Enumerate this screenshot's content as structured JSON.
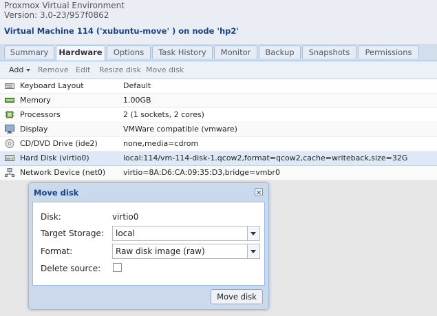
{
  "app": {
    "line1": "Proxmox Virtual Environment",
    "line2": "Version: 3.0-23/957f0862"
  },
  "vm_title": "Virtual Machine 114 ('xubuntu-move' ) on node 'hp2'",
  "tabs": [
    "Summary",
    "Hardware",
    "Options",
    "Task History",
    "Monitor",
    "Backup",
    "Snapshots",
    "Permissions"
  ],
  "active_tab": "Hardware",
  "toolbar": {
    "add": "Add",
    "remove": "Remove",
    "edit": "Edit",
    "resize": "Resize disk",
    "move": "Move disk"
  },
  "hardware": [
    {
      "label": "Keyboard Layout",
      "value": "Default",
      "icon": "keyboard-icon"
    },
    {
      "label": "Memory",
      "value": "1.00GB",
      "icon": "memory-icon"
    },
    {
      "label": "Processors",
      "value": "2 (1 sockets, 2 cores)",
      "icon": "cpu-icon"
    },
    {
      "label": "Display",
      "value": "VMWare compatible (vmware)",
      "icon": "display-icon"
    },
    {
      "label": "CD/DVD Drive (ide2)",
      "value": "none,media=cdrom",
      "icon": "cdrom-icon"
    },
    {
      "label": "Hard Disk (virtio0)",
      "value": "local:114/vm-114-disk-1.qcow2,format=qcow2,cache=writeback,size=32G",
      "icon": "harddisk-icon"
    },
    {
      "label": "Network Device (net0)",
      "value": "virtio=8A:D6:CA:09:35:D3,bridge=vmbr0",
      "icon": "network-icon"
    }
  ],
  "dialog": {
    "title": "Move disk",
    "disk_label": "Disk:",
    "disk_value": "virtio0",
    "storage_label": "Target Storage:",
    "storage_value": "local",
    "format_label": "Format:",
    "format_value": "Raw disk image (raw)",
    "delete_label": "Delete source:",
    "button": "Move disk"
  }
}
